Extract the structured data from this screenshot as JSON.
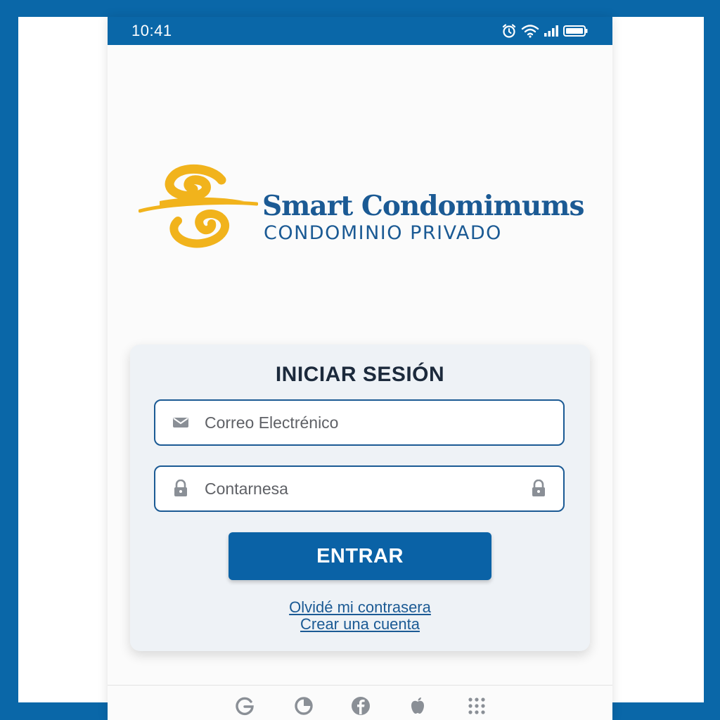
{
  "status_bar": {
    "time": "10:41",
    "icons": [
      "alarm-icon",
      "wifi-icon",
      "signal-icon",
      "battery-icon"
    ]
  },
  "brand": {
    "name": "Smart Condomimums",
    "subtitle": "CONDOMINIO PRIVADO",
    "logo_icon": "swirl-logo-icon",
    "colors": {
      "primary": "#1b5a94",
      "logo": "#f1b31c",
      "accent": "#0a67a8"
    }
  },
  "login": {
    "title": "INICIAR SESIÓN",
    "email_placeholder": "Correo Electrénico",
    "email_icon": "envelope-icon",
    "password_placeholder": "Contarnesa",
    "password_icons": [
      "lock-icon",
      "lock-icon"
    ],
    "submit_label": "ENTRAR",
    "forgot_link": "Olvidé mi contrasera",
    "create_link": "Crear una cuenta"
  },
  "social_bar": {
    "icons": [
      "google-icon",
      "circle-arc-icon",
      "facebook-icon",
      "apple-icon",
      "grid-menu-icon"
    ]
  }
}
